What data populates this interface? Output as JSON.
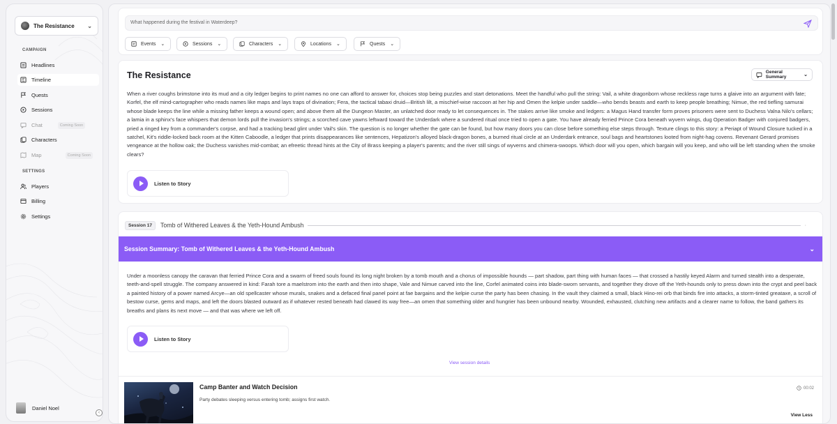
{
  "sidebar": {
    "campaign_name": "The Resistance",
    "campaign_section": "CAMPAIGN",
    "settings_section": "SETTINGS",
    "items": [
      {
        "label": "Headlines",
        "icon": "newspaper-icon"
      },
      {
        "label": "Timeline",
        "icon": "timeline-icon"
      },
      {
        "label": "Quests",
        "icon": "flag-icon"
      },
      {
        "label": "Sessions",
        "icon": "play-circle-icon"
      },
      {
        "label": "Chat",
        "icon": "chat-icon",
        "badge": "Coming Soon"
      },
      {
        "label": "Characters",
        "icon": "characters-icon"
      },
      {
        "label": "Map",
        "icon": "map-icon",
        "badge": "Coming Soon"
      }
    ],
    "settings_items": [
      {
        "label": "Players",
        "icon": "users-icon"
      },
      {
        "label": "Billing",
        "icon": "billing-icon"
      },
      {
        "label": "Settings",
        "icon": "gear-icon"
      }
    ],
    "user_name": "Daniel Noel"
  },
  "search": {
    "placeholder": "What happened during the festival in Waterdeep?",
    "filters": [
      "Events",
      "Sessions",
      "Characters",
      "Locations",
      "Quests"
    ]
  },
  "story": {
    "title": "The Resistance",
    "summary_select": "General Summary",
    "text": "When a river coughs brimstone into its mud and a city ledger begins to print names no one can afford to answer for, choices stop being puzzles and start detonations. Meet the handful who pull the string: Vail, a white dragonborn whose reckless rage turns a glaive into an argument with fate; Korfel, the elf mind-cartographer who reads names like maps and lays traps of divination; Fera, the tactical tabaxi druid—British lilt, a mischief-wise raccoon at her hip and Omen the kelpie under saddle—who bends beasts and earth to keep people breathing; Nimue, the red tiefling samurai whose blade keeps the line while a missing father keeps a wound open; and above them all the Dungeon Master, an unlatched door ready to let consequences in. The stakes arrive like smoke and ledgers: a Magus Hand transfer form proves prisoners were sent to Duchess Valna Nilo's cellars; a lamia in a sphinx's face whispers that demon lords pull the invasion's strings; a scorched cave yawns leftward toward the Underdark where a sundered ritual once tried to open a gate. You have already ferried Prince Cora beneath wyvern wings, dug Operation Badger with conjured badgers, pried a ringed key from a commander's corpse, and had a tracking bead glint under Vail's skin. The question is no longer whether the gate can be found, but how many doors you can close before something else steps through. Texture clings to this story: a Periapt of Wound Closure tucked in a satchel, Kit's riddle-locked back room at the Kitten Caboodle, a ledger that prints disappearances like sentences, Hepatizon's alloyed black-dragon bones, a burned ritual circle at an Underdark entrance, soul bags and heartstones looted from night-hag covens. Revenant Gerard promises vengeance at the hollow oak; the Duchess vanishes mid-combat; an efreetic thread hints at the City of Brass keeping a player's parents; and the river still sings of wyverns and chimera-swoops. Which door will you open, which bargain will you keep, and who will be left standing when the smoke clears?",
    "listen_label": "Listen to Story"
  },
  "session": {
    "badge": "Session 17",
    "name": "Tomb of Withered Leaves & the Yeth-Hound Ambush",
    "summary_title": "Session Summary: Tomb of Withered Leaves & the Yeth-Hound Ambush",
    "text": "Under a moonless canopy the caravan that ferried Prince Cora and a swarm of freed souls found its long night broken by a tomb mouth and a chorus of impossible hounds — part shadow, part thing with human faces — that crossed a hastily keyed Alarm and turned stealth into a desperate, teeth-and-spell struggle. The company answered in kind: Farah tore a maelstrom into the earth and then into shape, Vale and Nimue carved into the line, Corfel animated coins into blade-sworn servants, and together they drove off the Yeth-hounds only to press down into the crypt and peel back a painted history of a power named Arcye—an old spellcaster whose murals, snakes and a defaced final panel point at fae bargains and the kelpie curse the party has been chasing. In the vault they claimed a small, black Hino-rei orb that binds fire into attacks, a storm-tinted greataxe, a scroll of bestow curse, gems and maps, and left the doors blasted outward as if whatever rested beneath had clawed its way free—an omen that something older and hungrier has been unbound nearby. Wounded, exhausted, clutching new artifacts and a clearer name to follow, the band gathers its breaths and plans its next move — and that was where we left off.",
    "listen_label": "Listen to Story",
    "details_link": "View session details"
  },
  "event": {
    "title": "Camp Banter and Watch Decision",
    "description": "Party debates sleeping versus entering tomb; assigns first watch.",
    "time": "00:02",
    "toggle_label": "View Less"
  },
  "colors": {
    "accent": "#8b5cf6",
    "background": "#f1f1f4",
    "card": "#ffffff"
  }
}
